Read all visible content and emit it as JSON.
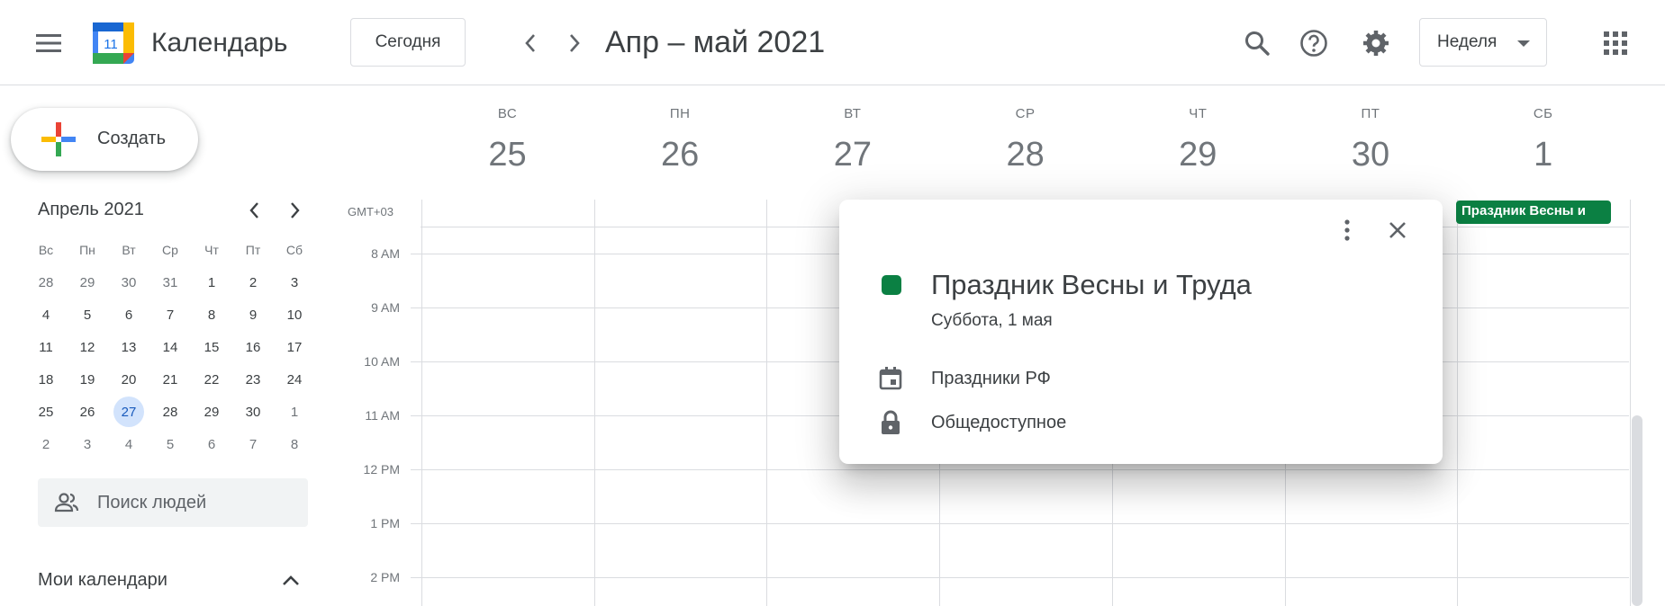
{
  "header": {
    "app_title": "Календарь",
    "logo_day": "11",
    "today_label": "Сегодня",
    "period": "Апр – май 2021",
    "view_label": "Неделя"
  },
  "sidebar": {
    "create_label": "Создать",
    "mini_calendar": {
      "title": "Апрель 2021",
      "weekdays": [
        "Вс",
        "Пн",
        "Вт",
        "Ср",
        "Чт",
        "Пт",
        "Сб"
      ],
      "weeks": [
        [
          "28",
          "29",
          "30",
          "31",
          "1",
          "2",
          "3"
        ],
        [
          "4",
          "5",
          "6",
          "7",
          "8",
          "9",
          "10"
        ],
        [
          "11",
          "12",
          "13",
          "14",
          "15",
          "16",
          "17"
        ],
        [
          "18",
          "19",
          "20",
          "21",
          "22",
          "23",
          "24"
        ],
        [
          "25",
          "26",
          "27",
          "28",
          "29",
          "30",
          "1"
        ],
        [
          "2",
          "3",
          "4",
          "5",
          "6",
          "7",
          "8"
        ]
      ],
      "today": "27"
    },
    "people_search_placeholder": "Поиск людей",
    "my_calendars_label": "Мои календари"
  },
  "week": {
    "days": [
      {
        "dow": "ВС",
        "num": "25"
      },
      {
        "dow": "ПН",
        "num": "26"
      },
      {
        "dow": "ВТ",
        "num": "27"
      },
      {
        "dow": "СР",
        "num": "28"
      },
      {
        "dow": "ЧТ",
        "num": "29"
      },
      {
        "dow": "ПТ",
        "num": "30"
      },
      {
        "dow": "СБ",
        "num": "1"
      }
    ],
    "timezone": "GMT+03",
    "hours": [
      "8 AM",
      "9 AM",
      "10 AM",
      "11 AM",
      "12 PM",
      "1 PM",
      "2 PM"
    ],
    "allday_event": "Праздник Весны и"
  },
  "popup": {
    "title": "Праздник Весны и Труда",
    "date": "Суббота, 1 мая",
    "calendar": "Праздники РФ",
    "visibility": "Общедоступное",
    "color": "#0b8043"
  }
}
